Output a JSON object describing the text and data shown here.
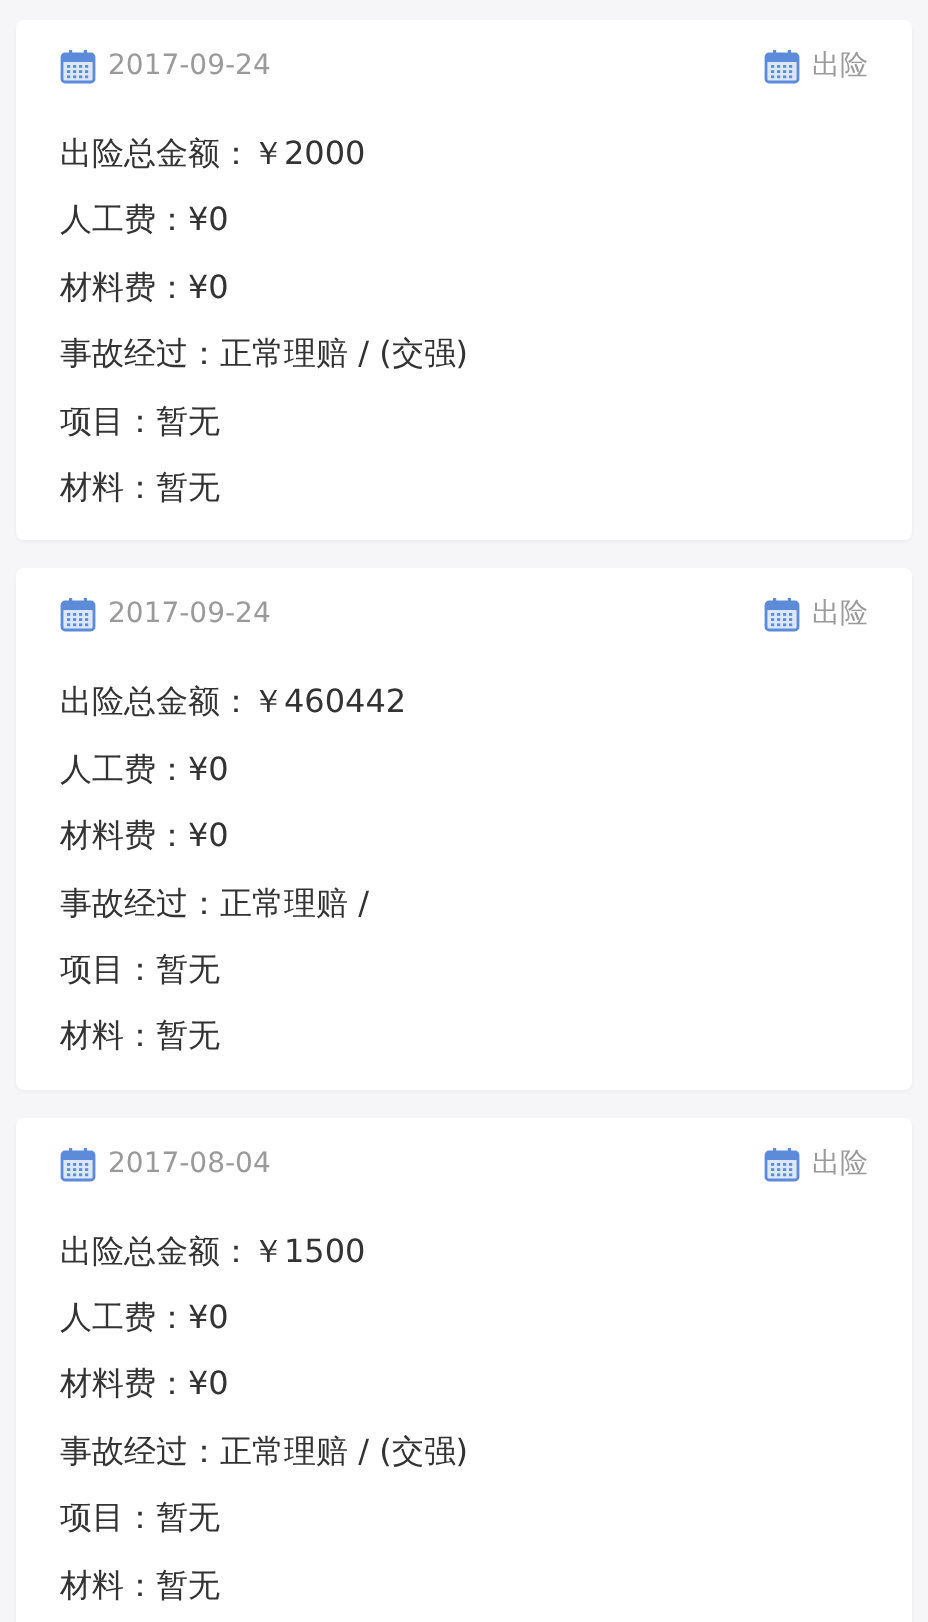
{
  "records": [
    {
      "date": "2017-09-24",
      "type": "出险",
      "lines": [
        "出险总金额：￥2000",
        "人工费：¥0",
        "材料费：¥0",
        "事故经过：正常理赔 / (交强)",
        "项目：暂无",
        "材料：暂无"
      ]
    },
    {
      "date": "2017-09-24",
      "type": "出险",
      "lines": [
        "出险总金额：￥460442",
        "人工费：¥0",
        "材料费：¥0",
        "事故经过：正常理赔 /",
        "项目：暂无",
        "材料：暂无"
      ]
    },
    {
      "date": "2017-08-04",
      "type": "出险",
      "lines": [
        "出险总金额：￥1500",
        "人工费：¥0",
        "材料费：¥0",
        "事故经过：正常理赔 / (交强)",
        "项目：暂无",
        "材料：暂无"
      ]
    }
  ]
}
